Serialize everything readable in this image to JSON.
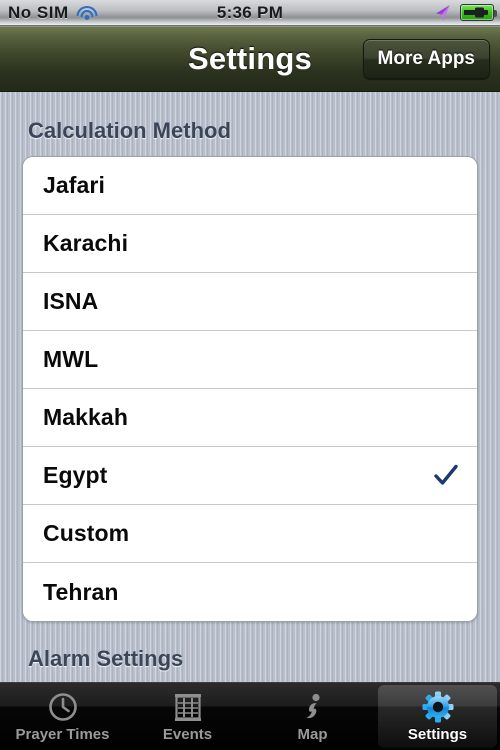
{
  "status_bar": {
    "carrier": "No SIM",
    "wifi_icon": "wifi-icon",
    "time": "5:36 PM",
    "location_icon": "location-arrow-icon",
    "battery_icon": "battery-charging-icon",
    "battery_color": "#3cc21a"
  },
  "nav_bar": {
    "title": "Settings",
    "more_apps_label": "More Apps"
  },
  "main": {
    "section_header": "Calculation Method",
    "next_section_header": "Alarm Settings",
    "selected_method": "Egypt",
    "checkmark_color": "#1c3a72",
    "methods": [
      {
        "label": "Jafari",
        "selected": false
      },
      {
        "label": "Karachi",
        "selected": false
      },
      {
        "label": "ISNA",
        "selected": false
      },
      {
        "label": "MWL",
        "selected": false
      },
      {
        "label": "Makkah",
        "selected": false
      },
      {
        "label": "Egypt",
        "selected": true
      },
      {
        "label": "Custom",
        "selected": false
      },
      {
        "label": "Tehran",
        "selected": false
      }
    ]
  },
  "tab_bar": {
    "active_tab": "Settings",
    "active_color": "#2e9fe8",
    "tabs": [
      {
        "label": "Prayer Times",
        "icon": "clock-icon",
        "active": false
      },
      {
        "label": "Events",
        "icon": "calendar-icon",
        "active": false
      },
      {
        "label": "Map",
        "icon": "info-icon",
        "active": false
      },
      {
        "label": "Settings",
        "icon": "gear-icon",
        "active": true
      }
    ]
  }
}
